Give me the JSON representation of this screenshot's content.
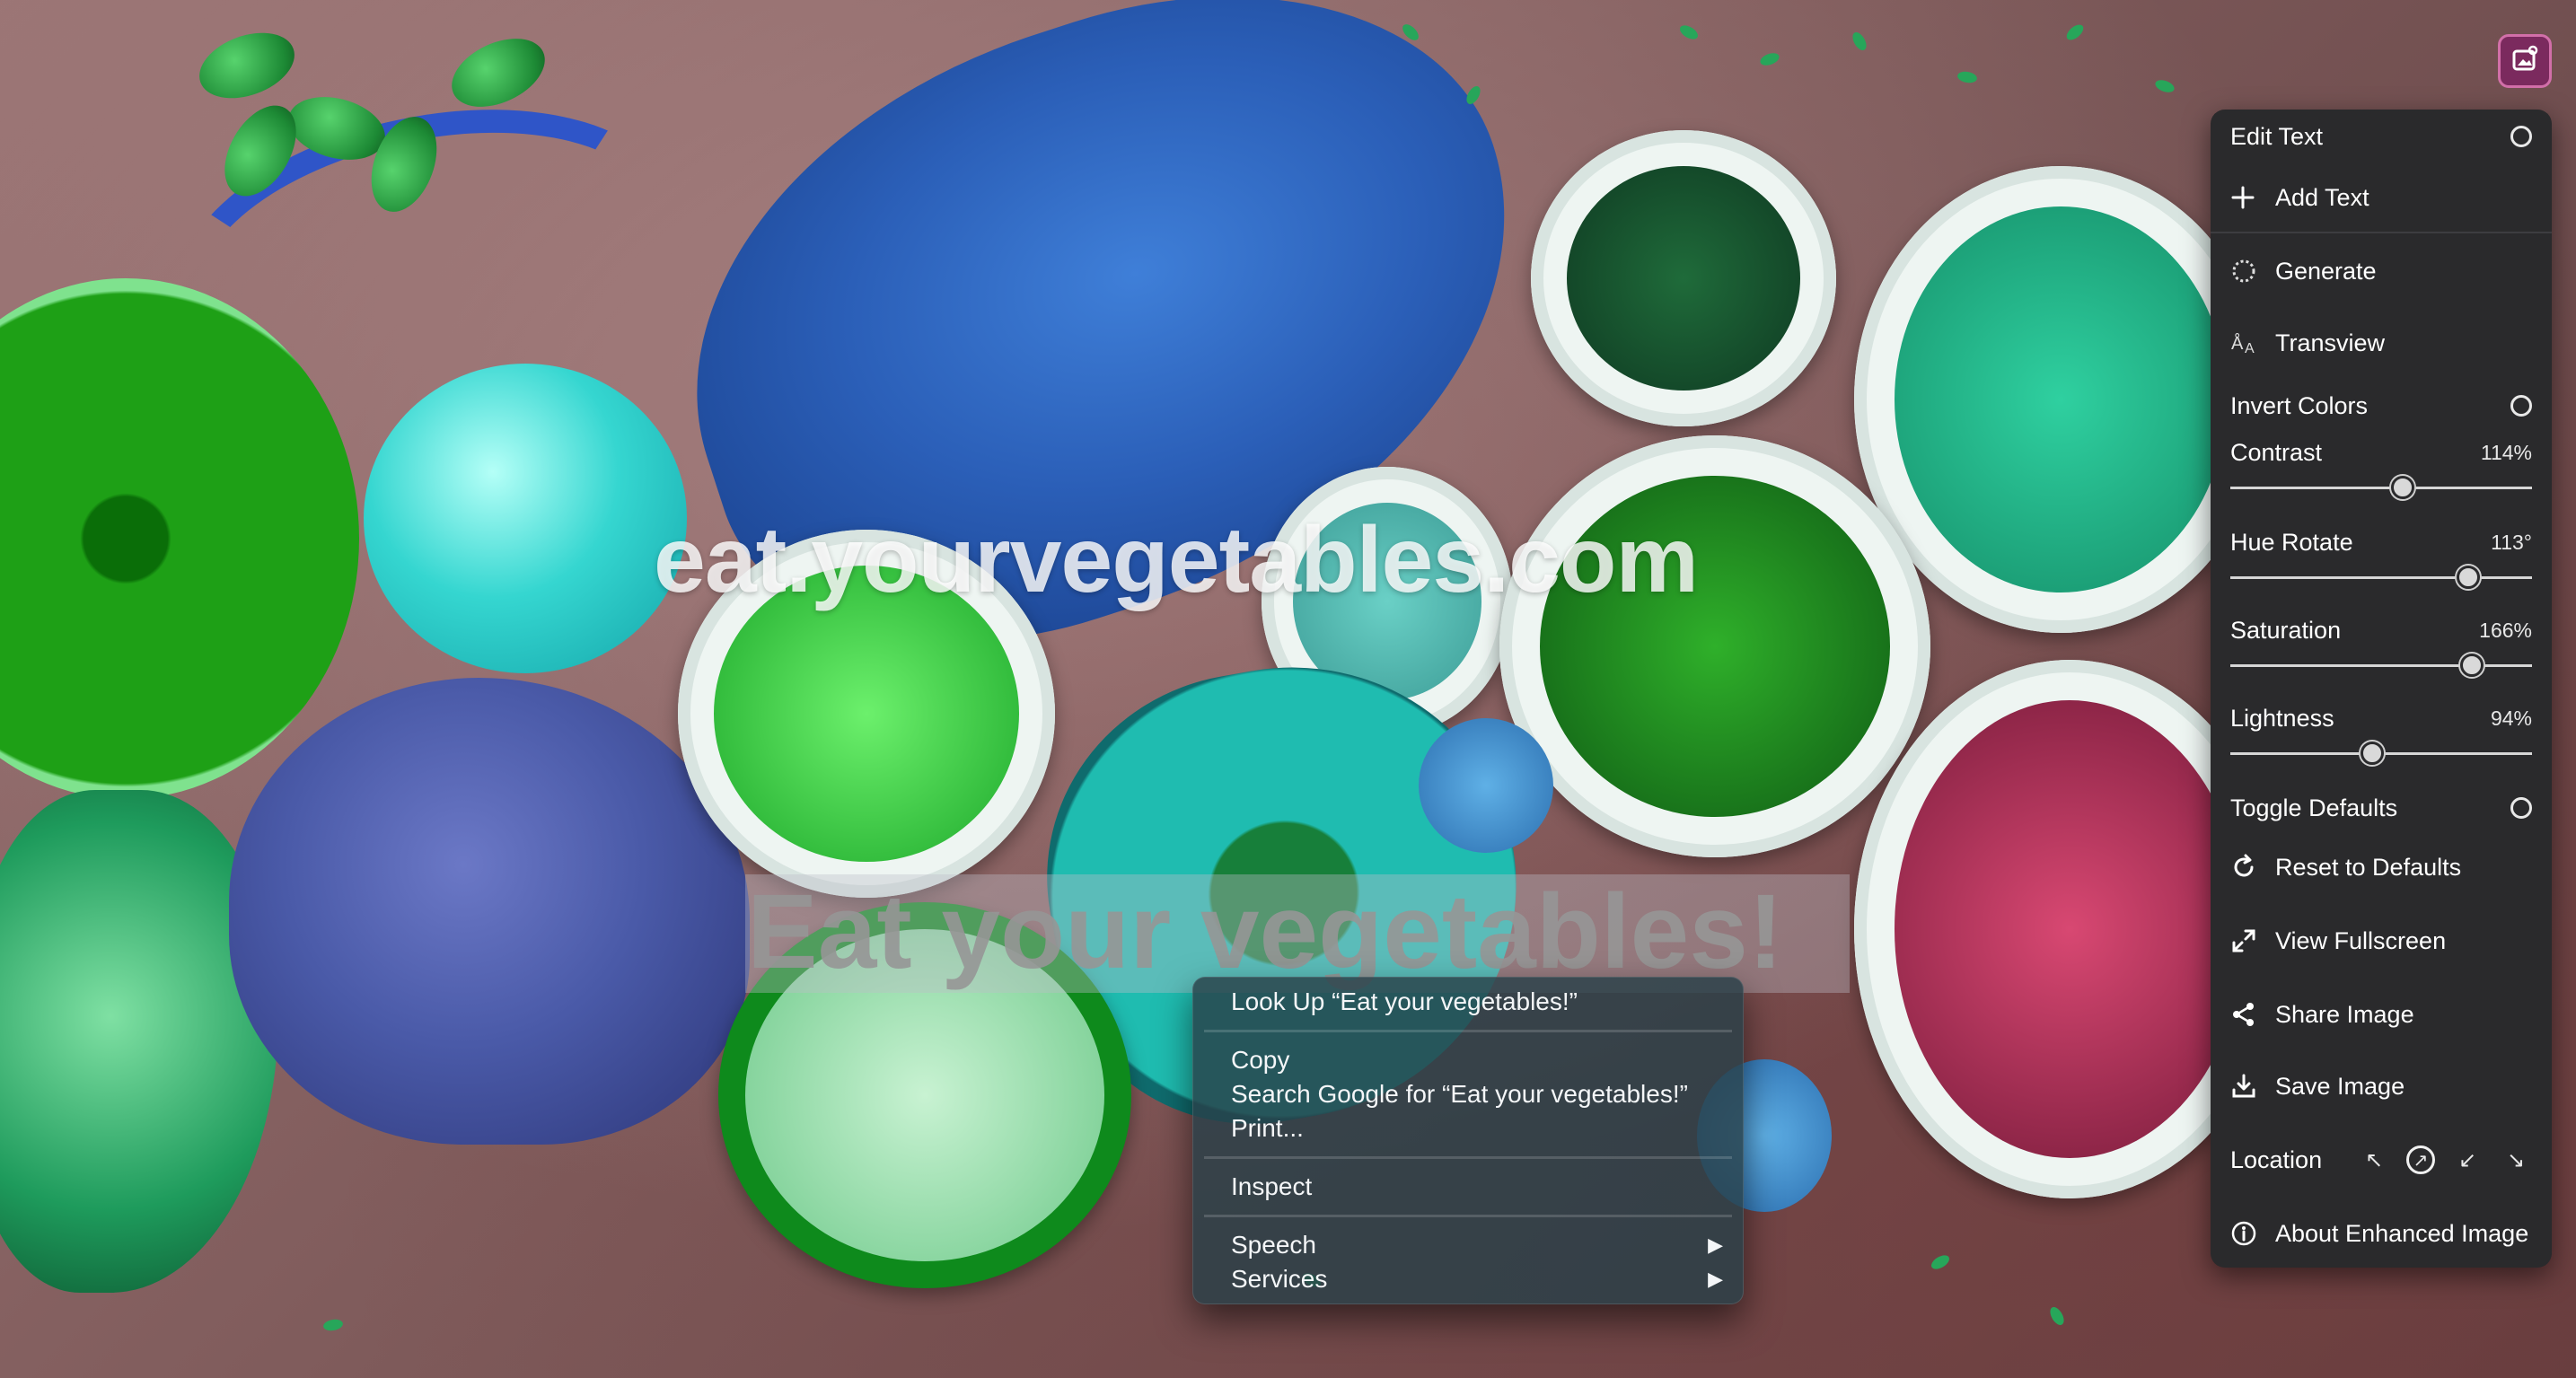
{
  "overlay": {
    "site_text": "eat.yourvegetables.com",
    "selected_text": "Eat your vegetables!"
  },
  "context_menu": {
    "items": [
      {
        "label": "Look Up “Eat your vegetables!”"
      },
      {
        "label": "Copy"
      },
      {
        "label": "Search Google for “Eat your vegetables!”"
      },
      {
        "label": "Print..."
      },
      {
        "label": "Inspect"
      },
      {
        "label": "Speech",
        "submenu_arrow": "▶"
      },
      {
        "label": "Services",
        "submenu_arrow": "▶"
      }
    ]
  },
  "panel": {
    "edit_text": "Edit Text",
    "add_text": "Add Text",
    "generate": "Generate",
    "transview": "Transview",
    "invert_colors": "Invert Colors",
    "contrast": {
      "label": "Contrast",
      "value_text": "114%",
      "fraction": 0.57
    },
    "hue_rotate": {
      "label": "Hue Rotate",
      "value_text": "113°",
      "fraction": 0.79
    },
    "saturation": {
      "label": "Saturation",
      "value_text": "166%",
      "fraction": 0.8
    },
    "lightness": {
      "label": "Lightness",
      "value_text": "94%",
      "fraction": 0.47
    },
    "toggle_defaults": "Toggle Defaults",
    "reset_defaults": "Reset to Defaults",
    "view_fullscreen": "View Fullscreen",
    "share_image": "Share Image",
    "save_image": "Save Image",
    "location": "Location",
    "about": "About Enhanced Image"
  },
  "colors": {
    "panel_bg": "#2a2a2c",
    "panel_button": "#7b2a5e",
    "context_menu_bg": "#284048"
  },
  "icons": [
    "panel-toggle-icon",
    "plus-icon",
    "generate-icon",
    "transview-icon",
    "reset-icon",
    "fullscreen-icon",
    "share-icon",
    "save-icon",
    "info-icon",
    "arrow-up-left-icon",
    "arrow-up-right-icon",
    "arrow-down-left-icon",
    "arrow-down-right-icon"
  ]
}
